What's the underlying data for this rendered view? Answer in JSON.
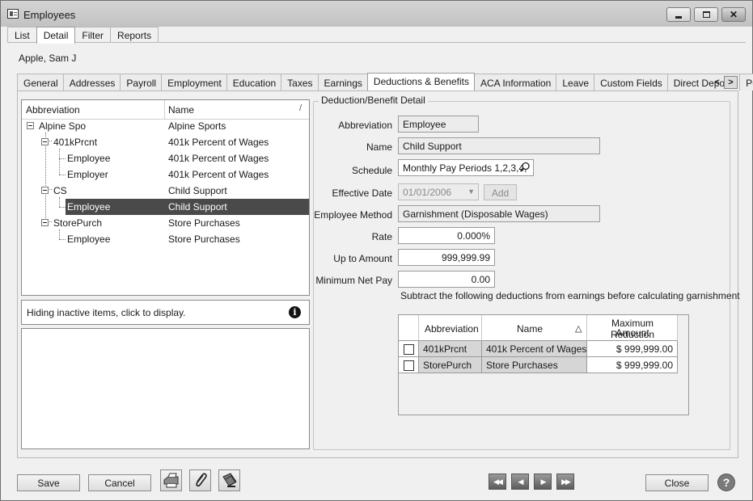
{
  "window": {
    "title": "Employees"
  },
  "top_tabs": [
    {
      "label": "List"
    },
    {
      "label": "Detail",
      "active": true
    },
    {
      "label": "Filter"
    },
    {
      "label": "Reports"
    }
  ],
  "record_name": "Apple, Sam J",
  "sub_tabs": [
    {
      "label": "General"
    },
    {
      "label": "Addresses"
    },
    {
      "label": "Payroll"
    },
    {
      "label": "Employment"
    },
    {
      "label": "Education"
    },
    {
      "label": "Taxes"
    },
    {
      "label": "Earnings"
    },
    {
      "label": "Deductions & Benefits",
      "active": true
    },
    {
      "label": "ACA Information"
    },
    {
      "label": "Leave"
    },
    {
      "label": "Custom Fields"
    },
    {
      "label": "Direct Deposit"
    },
    {
      "label": "Pu"
    }
  ],
  "tree": {
    "col_abbreviation": "Abbreviation",
    "col_name": "Name",
    "sort_glyph": "/",
    "rows": [
      {
        "abbr": "Alpine Spo",
        "name": "Alpine Sports",
        "level": 0,
        "expandable": true
      },
      {
        "abbr": "401kPrcnt",
        "name": "401k Percent of Wages",
        "level": 1,
        "expandable": true
      },
      {
        "abbr": "Employee",
        "name": "401k Percent of Wages",
        "level": 2
      },
      {
        "abbr": "Employer",
        "name": "401k Percent of Wages",
        "level": 2
      },
      {
        "abbr": "CS",
        "name": "Child Support",
        "level": 1,
        "expandable": true
      },
      {
        "abbr": "Employee",
        "name": "Child Support",
        "level": 2,
        "selected": true
      },
      {
        "abbr": "StorePurch",
        "name": "Store Purchases",
        "level": 1,
        "expandable": true
      },
      {
        "abbr": "Employee",
        "name": "Store Purchases",
        "level": 2
      }
    ]
  },
  "hiding_text": "Hiding inactive items, click to display.",
  "detail": {
    "group_title": "Deduction/Benefit Detail",
    "abbreviation": {
      "label": "Abbreviation",
      "value": "Employee"
    },
    "name": {
      "label": "Name",
      "value": "Child Support"
    },
    "schedule": {
      "label": "Schedule",
      "value": "Monthly Pay Periods 1,2,3,4,"
    },
    "effective_date": {
      "label": "Effective Date",
      "value": "01/01/2006",
      "add_label": "Add"
    },
    "employee_method": {
      "label": "Employee Method",
      "value": "Garnishment (Disposable Wages)"
    },
    "rate": {
      "label": "Rate",
      "value": "0.000%"
    },
    "up_to_amount": {
      "label": "Up to Amount",
      "value": "999,999.99"
    },
    "minimum_net_pay": {
      "label": "Minimum Net Pay",
      "value": "0.00"
    },
    "subtract_note": "Subtract the following deductions from earnings before calculating garnishment"
  },
  "grid": {
    "col_abbreviation": "Abbreviation",
    "col_name": "Name",
    "sort_glyph": "△",
    "col_max_line1": "Maximum Reduction",
    "col_max_line2": "Amount",
    "rows": [
      {
        "checked": false,
        "abbr": "401kPrcnt",
        "name": "401k Percent of Wages",
        "max": "$ 999,999.00"
      },
      {
        "checked": false,
        "abbr": "StorePurch",
        "name": "Store Purchases",
        "max": "$ 999,999.00"
      }
    ]
  },
  "footer": {
    "save_label": "Save",
    "cancel_label": "Cancel",
    "close_label": "Close",
    "help_glyph": "?",
    "nav_first": "◀◀",
    "nav_prev": "◀",
    "nav_next": "▶",
    "nav_last": "▶▶"
  },
  "icons": {
    "app": "employees-app-icon",
    "print": "print-icon",
    "attach": "paperclip-icon",
    "report": "report-icon",
    "info": "info-icon",
    "help": "help-icon",
    "lookup": "magnifier-icon"
  }
}
